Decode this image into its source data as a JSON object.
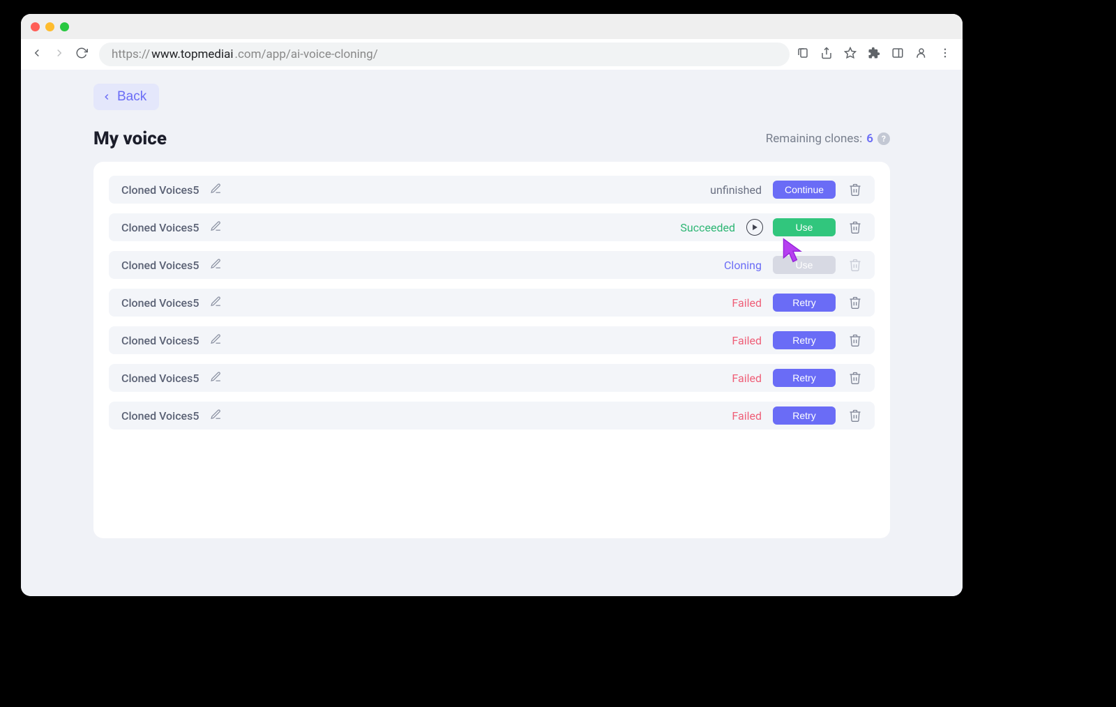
{
  "browser": {
    "url_prefix": "https://",
    "url_host": "www.topmediai",
    "url_suffix": ".com/app/ai-voice-cloning/"
  },
  "page": {
    "back_label": "Back",
    "title": "My voice",
    "remaining_label": "Remaining clones:",
    "remaining_count": "6"
  },
  "buttons": {
    "continue": "Continue",
    "use": "Use",
    "retry": "Retry"
  },
  "rows": [
    {
      "name": "Cloned Voices5",
      "status": "unfinished",
      "status_class": "unfinished",
      "action": "continue",
      "has_play": false,
      "disabled": false
    },
    {
      "name": "Cloned Voices5",
      "status": "Succeeded",
      "status_class": "succeeded",
      "action": "use",
      "has_play": true,
      "disabled": false
    },
    {
      "name": "Cloned Voices5",
      "status": "Cloning",
      "status_class": "cloning",
      "action": "use",
      "has_play": false,
      "disabled": true
    },
    {
      "name": "Cloned Voices5",
      "status": "Failed",
      "status_class": "failed",
      "action": "retry",
      "has_play": false,
      "disabled": false
    },
    {
      "name": "Cloned Voices5",
      "status": "Failed",
      "status_class": "failed",
      "action": "retry",
      "has_play": false,
      "disabled": false
    },
    {
      "name": "Cloned Voices5",
      "status": "Failed",
      "status_class": "failed",
      "action": "retry",
      "has_play": false,
      "disabled": false
    },
    {
      "name": "Cloned Voices5",
      "status": "Failed",
      "status_class": "failed",
      "action": "retry",
      "has_play": false,
      "disabled": false
    }
  ]
}
